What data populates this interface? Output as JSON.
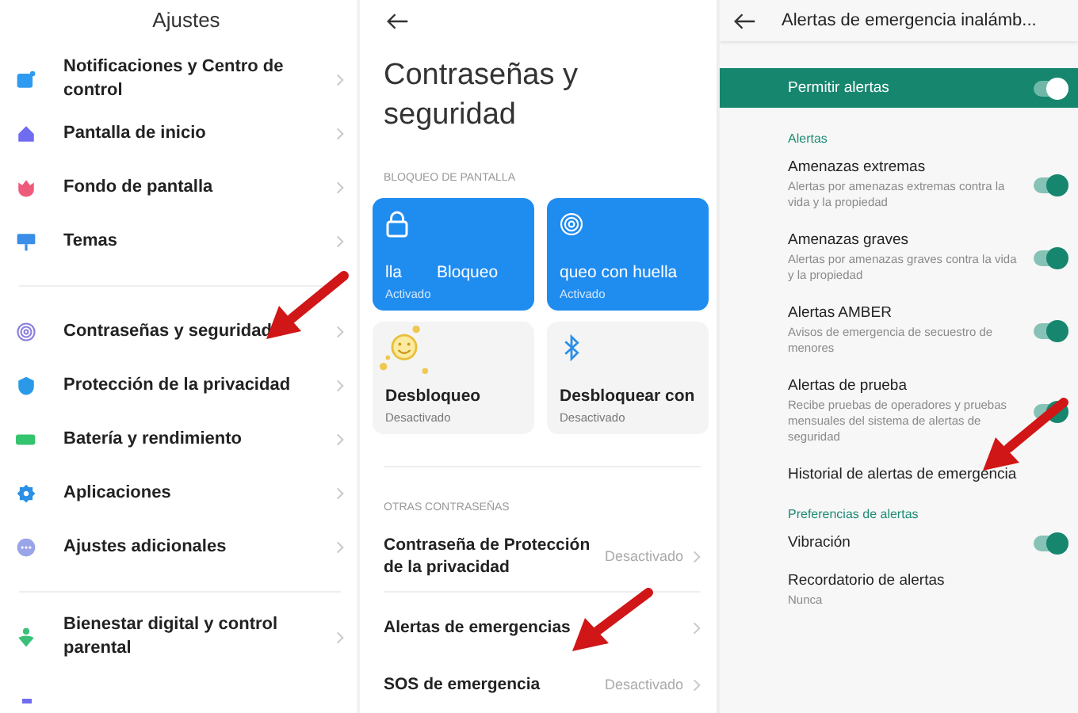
{
  "settings": {
    "title": "Ajustes",
    "groups": [
      {
        "items": [
          {
            "label": "Notificaciones y Centro de control",
            "kind": "notif",
            "color": "#2f9bf0"
          },
          {
            "label": "Pantalla de inicio",
            "kind": "home",
            "color": "#6f6cf0"
          },
          {
            "label": "Fondo de pantalla",
            "kind": "flower",
            "color": "#ee5b7a"
          },
          {
            "label": "Temas",
            "kind": "brush",
            "color": "#3a8ee8"
          }
        ]
      },
      {
        "items": [
          {
            "label": "Contraseñas y seguridad",
            "kind": "fingerprint",
            "color": "#8a7fe0"
          },
          {
            "label": "Protección de la privacidad",
            "kind": "shield",
            "color": "#2a9ae8"
          },
          {
            "label": "Batería y rendimiento",
            "kind": "battery",
            "color": "#35c46e"
          },
          {
            "label": "Aplicaciones",
            "kind": "gear",
            "color": "#2a8fe6"
          },
          {
            "label": "Ajustes adicionales",
            "kind": "dots",
            "color": "#9aa4e8"
          }
        ]
      },
      {
        "items": [
          {
            "label": "Bienestar digital y control parental",
            "kind": "person",
            "color": "#3ac07a"
          }
        ]
      }
    ]
  },
  "security": {
    "title": "Contraseñas y seguridad",
    "lock_section": "BLOQUEO DE PANTALLA",
    "cards": [
      {
        "title_parts": [
          "lla",
          "Bloqueo"
        ],
        "status": "Activado",
        "on": true,
        "kind": "lock"
      },
      {
        "title_parts": [
          "queo con huella"
        ],
        "status": "Activado",
        "on": true,
        "kind": "fingerprint"
      },
      {
        "title_parts": [
          "Desbloqueo"
        ],
        "status": "Desactivado",
        "on": false,
        "kind": "face"
      },
      {
        "title_parts": [
          "Desbloquear con"
        ],
        "status": "Desactivado",
        "on": false,
        "kind": "bluetooth"
      }
    ],
    "other_section": "OTRAS CONTRASEÑAS",
    "rows": [
      {
        "label": "Contraseña de Protección de la privacidad",
        "value": "Desactivado"
      },
      {
        "label": "Alertas de emergencias"
      },
      {
        "label": "SOS de emergencia",
        "value": "Desactivado"
      }
    ]
  },
  "alerts": {
    "title": "Alertas de emergencia inalámb...",
    "master": {
      "label": "Permitir alertas",
      "on": true
    },
    "sections": [
      {
        "title": "Alertas",
        "items": [
          {
            "title": "Amenazas extremas",
            "summary": "Alertas por amenazas extremas contra la vida y la propiedad",
            "on": true,
            "kind": "toggle"
          },
          {
            "title": "Amenazas graves",
            "summary": "Alertas por amenazas graves contra la vida y la propiedad",
            "on": true,
            "kind": "toggle"
          },
          {
            "title": "Alertas AMBER",
            "summary": "Avisos de emergencia de secuestro de menores",
            "on": true,
            "kind": "toggle"
          },
          {
            "title": "Alertas de prueba",
            "summary": "Recibe pruebas de operadores y pruebas mensuales del sistema de alertas de seguridad",
            "on": true,
            "kind": "toggle"
          },
          {
            "title": "Historial de alertas de emergencia",
            "kind": "link"
          }
        ]
      },
      {
        "title": "Preferencias de alertas",
        "items": [
          {
            "title": "Vibración",
            "on": true,
            "kind": "toggle"
          },
          {
            "title": "Recordatorio de alertas",
            "summary": "Nunca",
            "kind": "link"
          }
        ]
      }
    ]
  }
}
